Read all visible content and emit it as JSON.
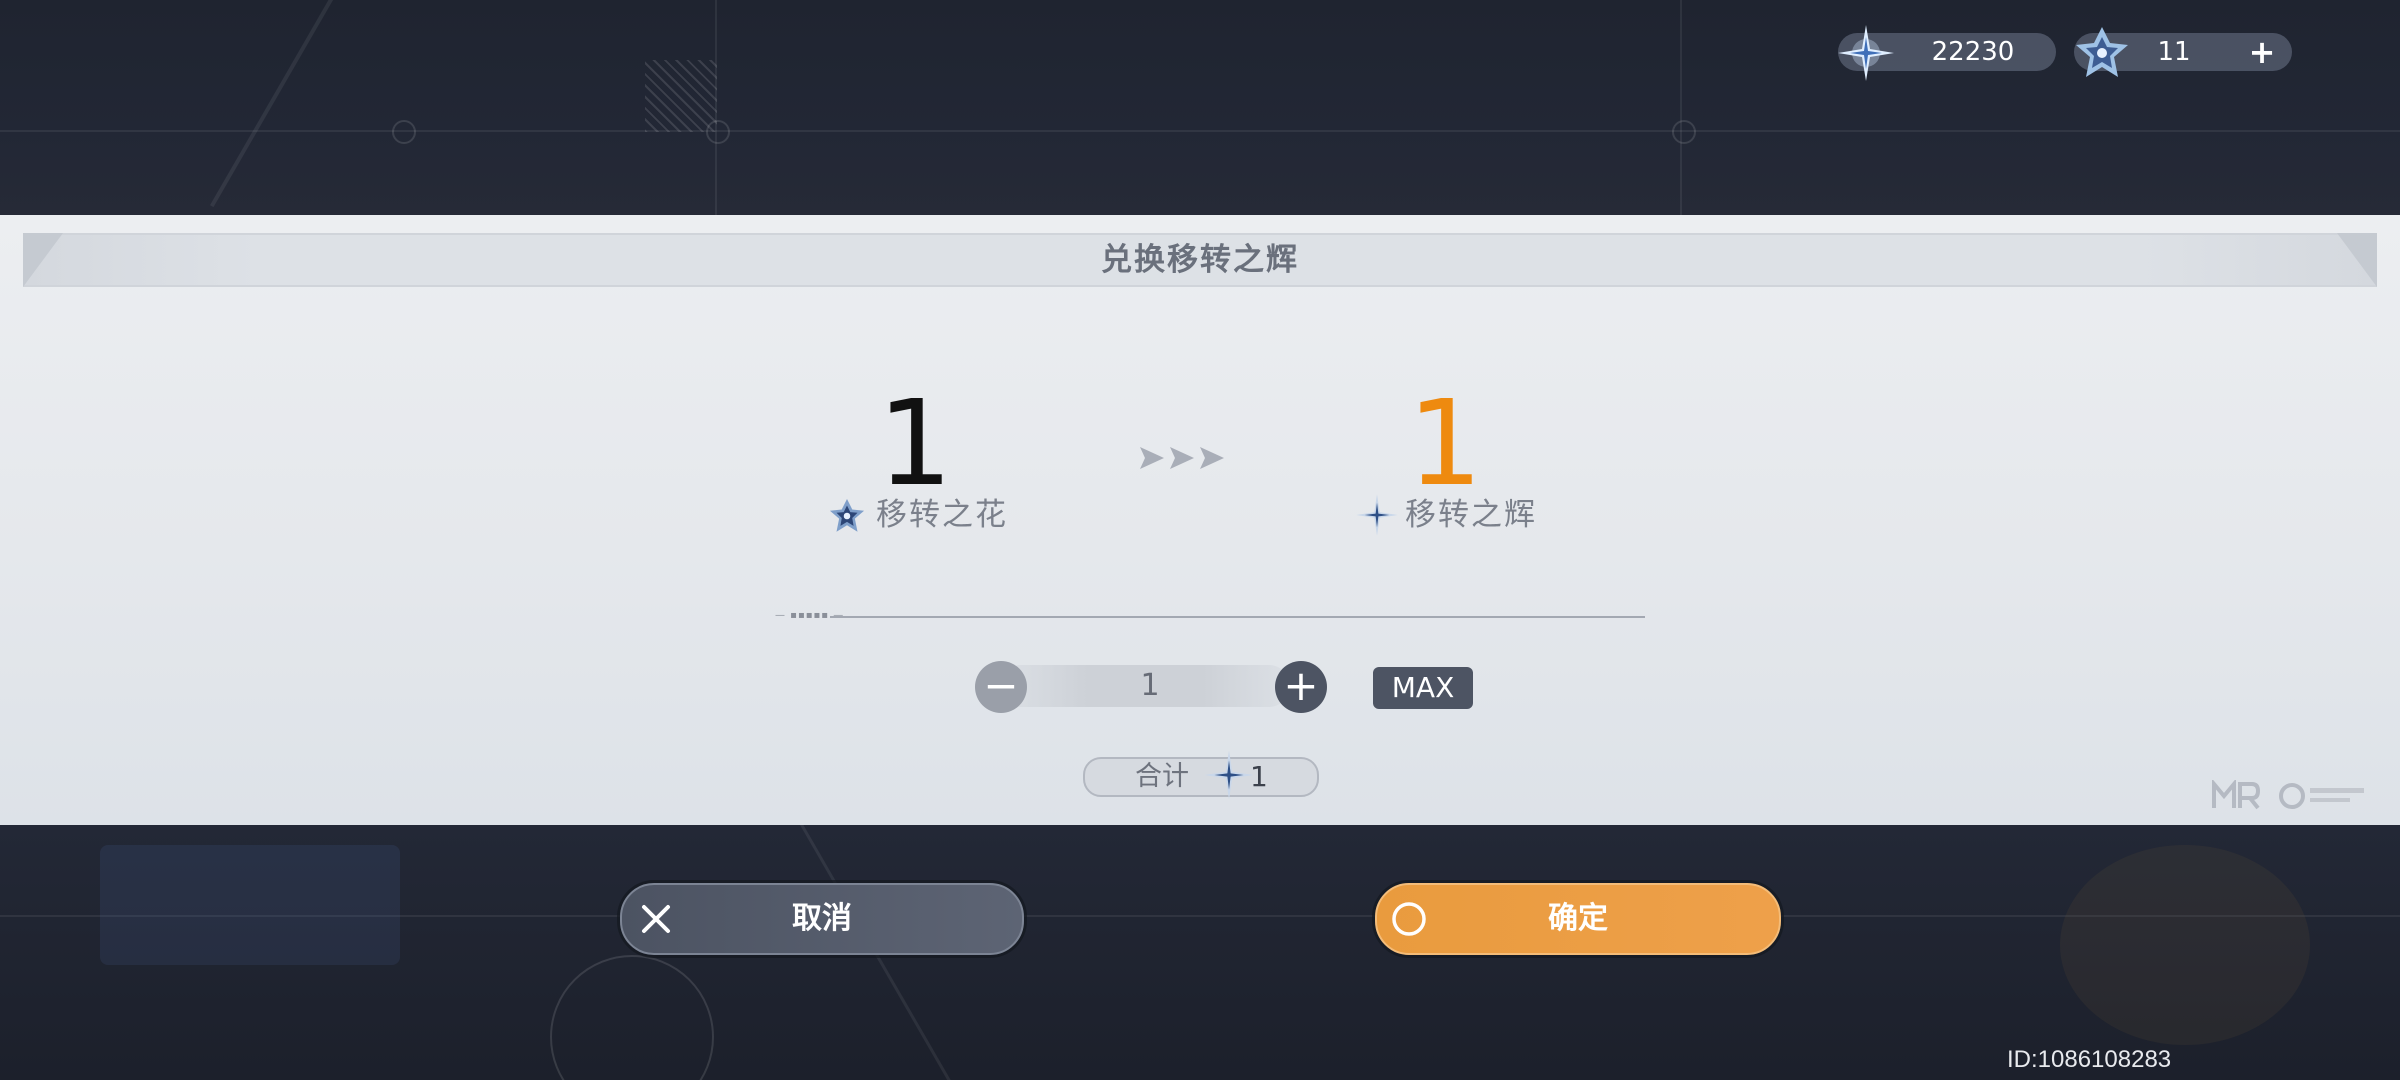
{
  "header": {
    "currency_glow": {
      "icon": "transfer-radiance-star-icon",
      "value": "22230"
    },
    "currency_flower": {
      "icon": "transfer-flower-crystal-icon",
      "value": "11",
      "add_label": "+"
    }
  },
  "dialog": {
    "title": "兑换移转之辉",
    "source": {
      "amount": "1",
      "icon": "transfer-flower-crystal-icon",
      "name": "移转之花"
    },
    "target": {
      "amount": "1",
      "icon": "transfer-radiance-star-icon",
      "name": "移转之辉"
    },
    "quantity": {
      "value": "1",
      "minus_label": "−",
      "plus_label": "+",
      "max_label": "MAX"
    },
    "total": {
      "label": "合计",
      "icon": "transfer-radiance-star-icon",
      "value": "1"
    }
  },
  "actions": {
    "cancel_label": "取消",
    "confirm_label": "确定"
  },
  "footer": {
    "uid": "ID:1086108283"
  },
  "colors": {
    "accent_orange": "#ee8a0f",
    "confirm_bg": "#eaa048",
    "cancel_bg": "#555c6b",
    "panel_bg": "#e6e9ed"
  }
}
